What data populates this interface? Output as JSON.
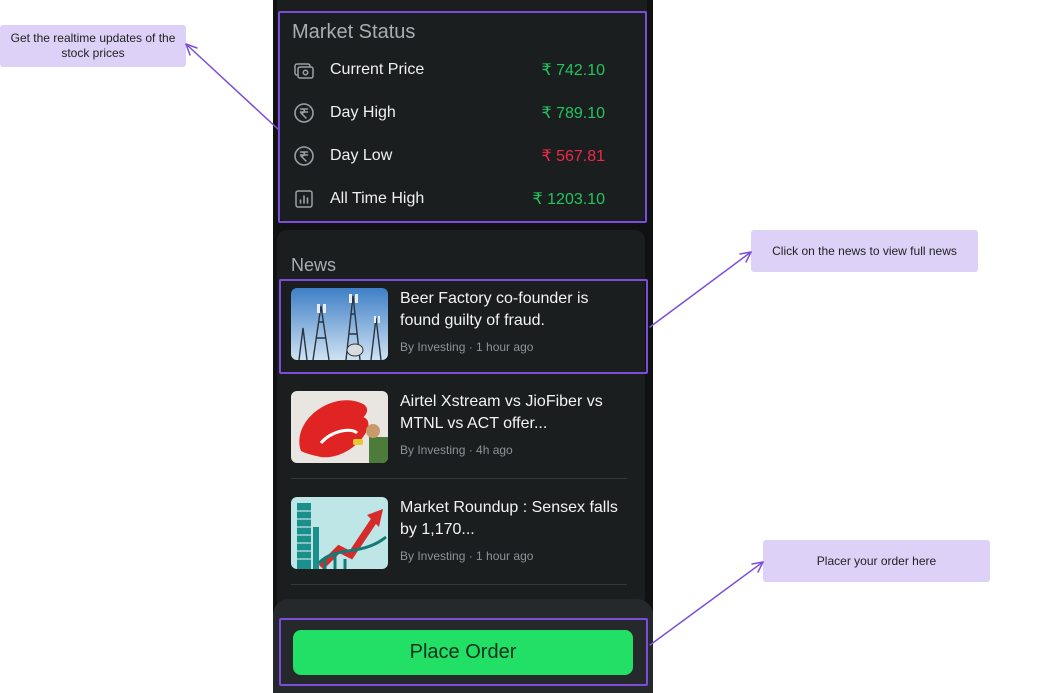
{
  "market_status": {
    "title": "Market Status",
    "rows": [
      {
        "icon": "cash-icon",
        "label": "Current Price",
        "value": "₹ 742.10",
        "trend": "up"
      },
      {
        "icon": "rupee-circle-icon",
        "label": "Day High",
        "value": "₹ 789.10",
        "trend": "up"
      },
      {
        "icon": "rupee-circle-icon",
        "label": "Day Low",
        "value": "₹ 567.81",
        "trend": "down"
      },
      {
        "icon": "bar-chart-icon",
        "label": "All Time High",
        "value": "₹ 1203.10",
        "trend": "up"
      }
    ]
  },
  "news": {
    "title": "News",
    "items": [
      {
        "headline": "Beer Factory co-founder is found guilty of fraud.",
        "meta": "By Investing · 1 hour ago",
        "thumb": "telecom-towers"
      },
      {
        "headline": "Airtel Xstream vs JioFiber vs MTNL vs ACT offer...",
        "meta": "By Investing · 4h ago",
        "thumb": "airtel-logo"
      },
      {
        "headline": "Market Roundup : Sensex falls by 1,170...",
        "meta": "By Investing · 1 hour ago",
        "thumb": "stock-exchange"
      }
    ]
  },
  "place_order": {
    "label": "Place Order"
  },
  "annotations": {
    "realtime": "Get the realtime updates of the stock prices",
    "news": "Click on the news to view full news",
    "order": "Placer your order here"
  },
  "colors": {
    "accent": "#7c4ddb",
    "up": "#22c55e",
    "down": "#f0284a",
    "button": "#22e065",
    "callout": "#ddd1f7"
  }
}
